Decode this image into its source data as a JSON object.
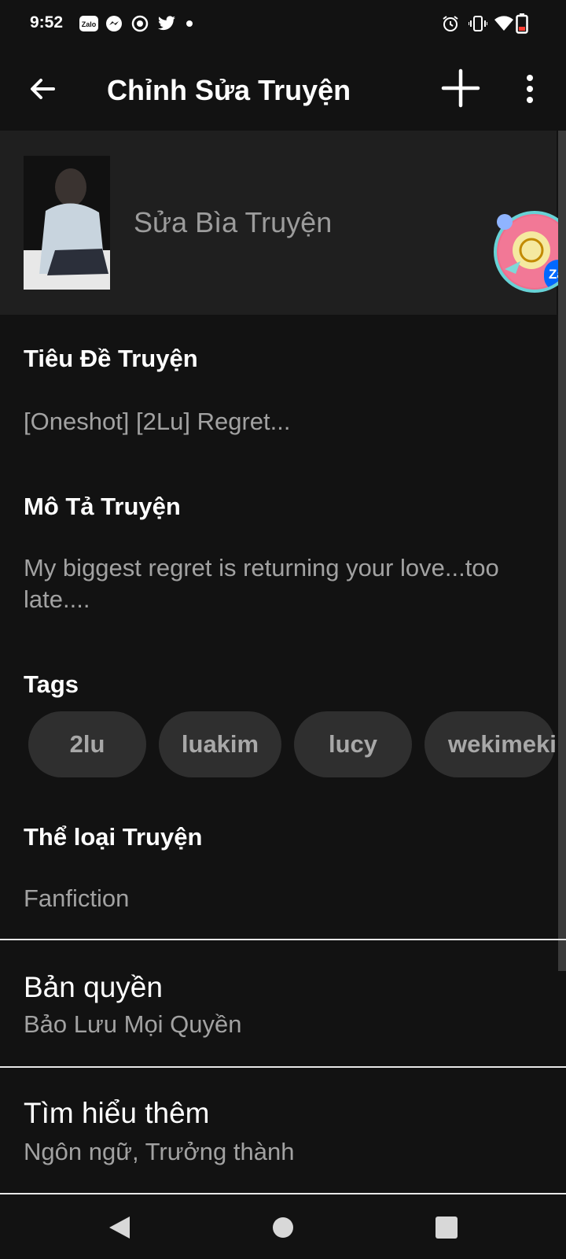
{
  "status_bar": {
    "time": "9:52",
    "left_icons": [
      "zalo-icon",
      "messenger-icon",
      "podcast-icon",
      "twitter-icon",
      "dot-icon"
    ],
    "right_icons": [
      "alarm-icon",
      "vibrate-icon",
      "wifi-icon",
      "battery-low-icon"
    ],
    "zalo_badge": "Zalo"
  },
  "app_bar": {
    "title": "Chỉnh Sửa Truyện"
  },
  "cover": {
    "label": "Sửa Bìa Truyện"
  },
  "floating_bubble": {
    "badge": "Zal"
  },
  "story_title": {
    "label": "Tiêu Đề Truyện",
    "value": "[Oneshot] [2Lu] Regret..."
  },
  "story_description": {
    "label": "Mô Tả Truyện",
    "value": "My biggest regret is returning your love...too late...."
  },
  "tags": {
    "label": "Tags",
    "items": [
      "2lu",
      "luakim",
      "lucy",
      "wekimeki"
    ]
  },
  "category": {
    "label": "Thể loại Truyện",
    "value": "Fanfiction"
  },
  "copyright": {
    "title": "Bản quyền",
    "subtitle": "Bảo Lưu Mọi Quyền"
  },
  "learn_more": {
    "title": "Tìm hiểu thêm",
    "subtitle": "Ngôn ngữ, Trưởng thành"
  },
  "colors": {
    "background": "#121212",
    "cover_section": "#1f1f1f",
    "chip": "#2f2f2f",
    "muted_text": "#a2a2a2"
  }
}
